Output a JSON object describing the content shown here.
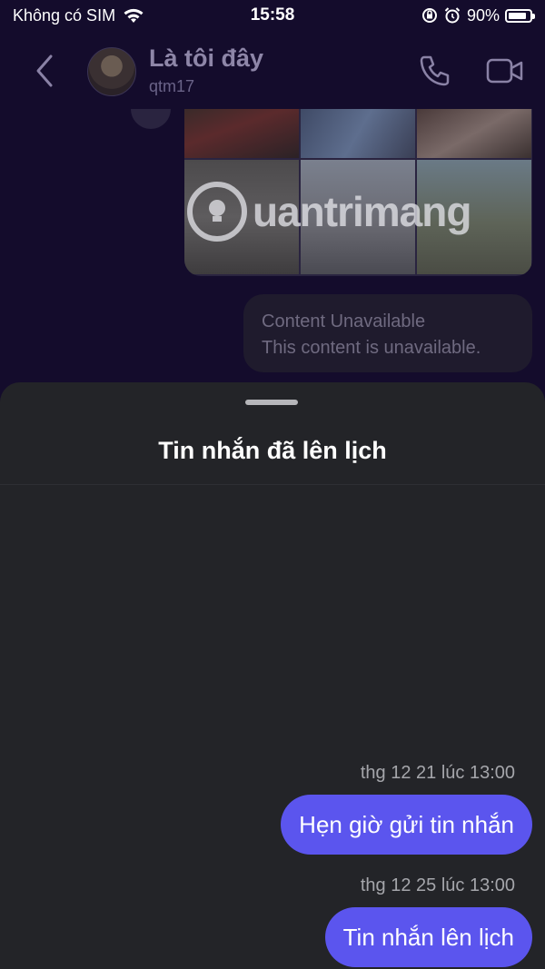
{
  "status_bar": {
    "carrier": "Không có SIM",
    "time": "15:58",
    "battery": "90%",
    "battery_level": 0.9
  },
  "chat_header": {
    "contact_name": "Là tôi đây",
    "username": "qtm17"
  },
  "media": {
    "watermark": "uantrimang"
  },
  "unavailable_message": {
    "title": "Content Unavailable",
    "body": "This content is unavailable."
  },
  "sheet": {
    "title": "Tin nhắn đã lên lịch",
    "messages": [
      {
        "time": "thg 12 21 lúc 13:00",
        "text": "Hẹn giờ gửi tin nhắn"
      },
      {
        "time": "thg 12 25 lúc 13:00",
        "text": "Tin nhắn lên lịch"
      }
    ]
  },
  "colors": {
    "chat_background": "#140c2c",
    "sheet_background": "#232428",
    "bubble_accent": "#5b55ee"
  }
}
